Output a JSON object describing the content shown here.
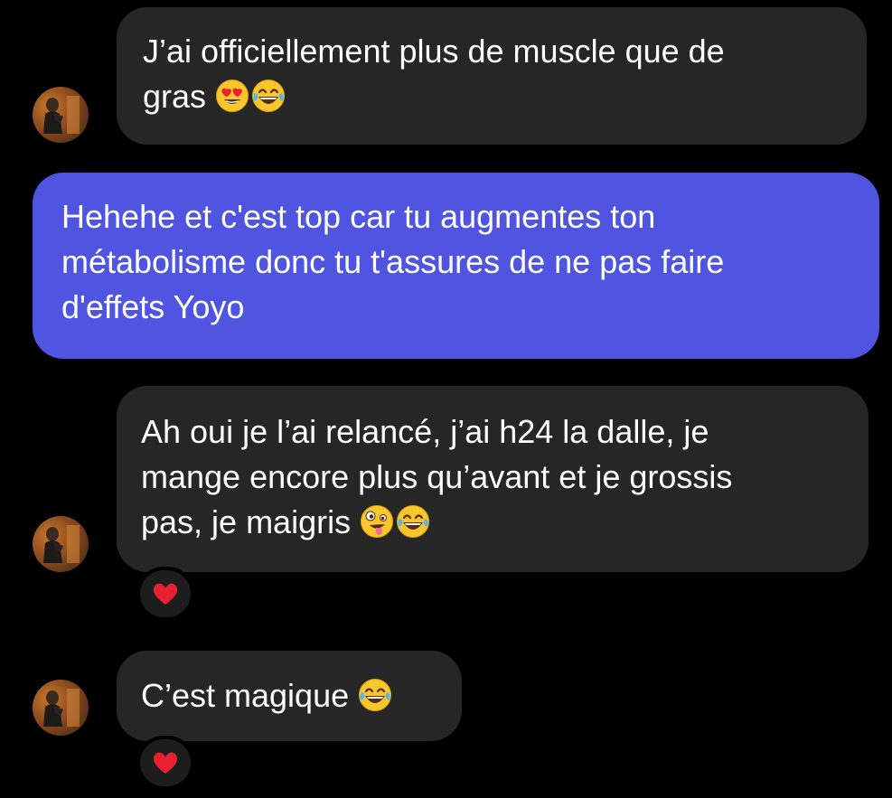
{
  "conversation": {
    "messages": [
      {
        "sender": "contact",
        "text": "J’ai officiellement plus de muscle que de\ngras",
        "emojis": [
          "heart-eyes-emoji",
          "tears-of-joy-emoji"
        ],
        "reaction": null
      },
      {
        "sender": "me",
        "text": "Hehehe et c'est top car tu augmentes ton\nmétabolisme donc tu t'assures de ne pas faire\nd'effets Yoyo",
        "emojis": [],
        "reaction": null
      },
      {
        "sender": "contact",
        "text": "Ah oui je l’ai relancé, j’ai h24 la dalle, je\nmange encore plus qu’avant et je grossis\npas, je maigris",
        "emojis": [
          "zany-face-emoji",
          "tears-of-joy-emoji"
        ],
        "reaction": "heart-icon"
      },
      {
        "sender": "contact",
        "text": "C’est magique",
        "emojis": [
          "tears-of-joy-emoji"
        ],
        "reaction": "heart-icon"
      }
    ]
  },
  "colors": {
    "background": "#000000",
    "incoming_bubble": "#262626",
    "outgoing_bubble": "#4f55e0",
    "text": "#ffffff",
    "reaction_heart": "#e8202f"
  }
}
